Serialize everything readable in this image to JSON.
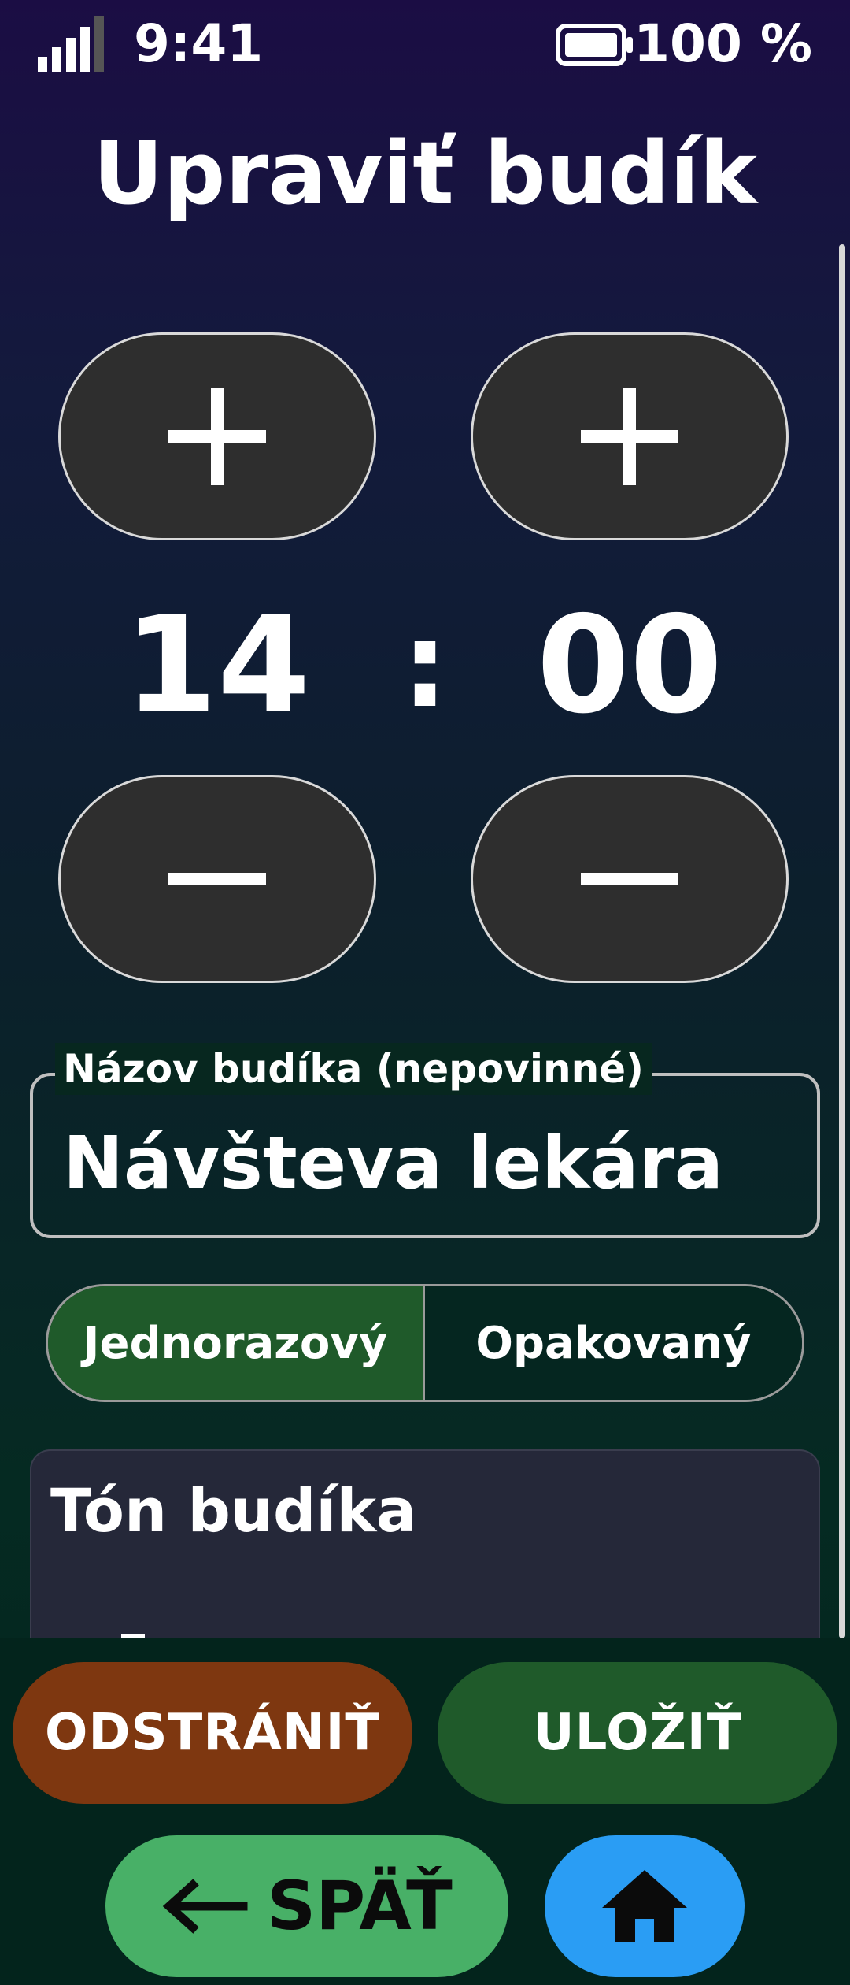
{
  "status_bar": {
    "time": "9:41",
    "battery": "100 %",
    "signal_icon": "signal-icon",
    "battery_icon": "battery-icon"
  },
  "header": {
    "title": "Upraviť budík"
  },
  "time_picker": {
    "hours": "14",
    "separator": ":",
    "minutes": "00",
    "increment_icon": "plus-icon",
    "decrement_icon": "minus-icon"
  },
  "name_field": {
    "label": "Názov budíka (nepovinné)",
    "value": "Návšteva lekára"
  },
  "repeat_mode": {
    "options": [
      "Jednorazový",
      "Opakovaný"
    ],
    "selected": "Jednorazový"
  },
  "tone_section": {
    "title": "Tón budíka"
  },
  "actions": {
    "delete_label": "ODSTRÁNIŤ",
    "save_label": "ULOŽIŤ",
    "back_label": "SPÄŤ",
    "back_icon": "arrow-left-icon",
    "home_icon": "home-icon"
  },
  "colors": {
    "save": "#1f5a2a",
    "delete": "#7e3710",
    "back": "#48b067",
    "home": "#2a9df4",
    "selected_segment": "#1f5a2a"
  }
}
